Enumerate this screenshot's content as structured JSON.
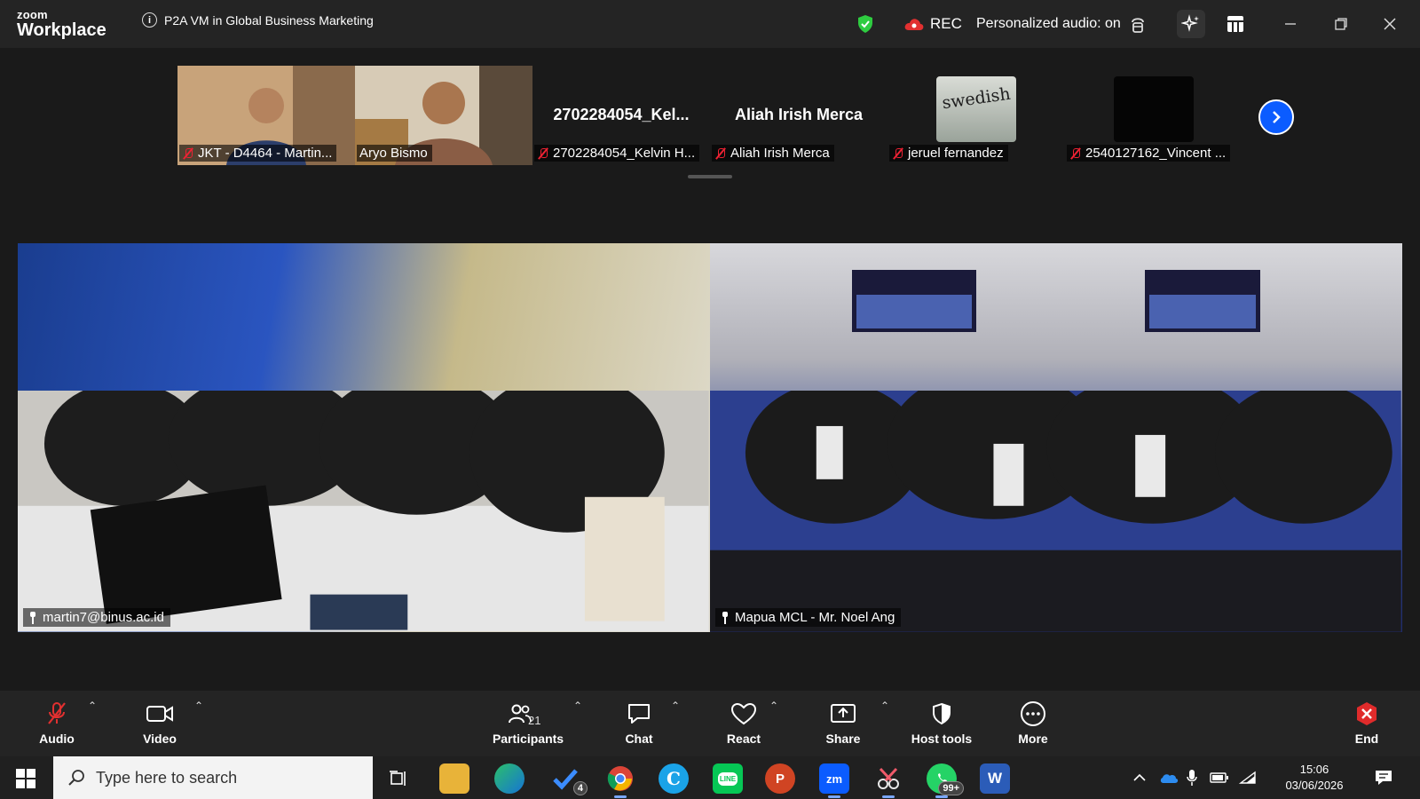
{
  "app": {
    "brand_top": "zoom",
    "brand_bottom": "Workplace"
  },
  "meeting": {
    "title": "P2A VM in Global Business Marketing"
  },
  "header": {
    "rec_label": "REC",
    "personalized_audio": "Personalized audio: on"
  },
  "colors": {
    "accent": "#0b5cff",
    "muted_red": "#e23030",
    "shield_green": "#2ecc40",
    "end_red": "#e02b2b"
  },
  "thumbnails": [
    {
      "big_name": "",
      "name": "JKT - D4464 - Martin...",
      "muted": true,
      "kind": "video"
    },
    {
      "big_name": "",
      "name": "Aryo Bismo",
      "muted": false,
      "kind": "video"
    },
    {
      "big_name": "2702284054_Kel...",
      "name": "2702284054_Kelvin H...",
      "muted": true,
      "kind": "blank"
    },
    {
      "big_name": "Aliah Irish Merca",
      "name": "Aliah Irish Merca",
      "muted": true,
      "kind": "blank"
    },
    {
      "big_name": "",
      "name": "jeruel fernandez",
      "muted": true,
      "kind": "avatar"
    },
    {
      "big_name": "",
      "name": "2540127162_Vincent ...",
      "muted": true,
      "kind": "dark"
    }
  ],
  "avatar_text": "swedish",
  "videos": [
    {
      "name": "martin7@binus.ac.id"
    },
    {
      "name": "Mapua MCL - Mr. Noel Ang"
    }
  ],
  "toolbar": {
    "audio": "Audio",
    "video": "Video",
    "participants": "Participants",
    "participants_count": "21",
    "chat": "Chat",
    "react": "React",
    "share": "Share",
    "host_tools": "Host tools",
    "more": "More",
    "end": "End"
  },
  "taskbar": {
    "search_placeholder": "Type here to search",
    "todo_badge": "4",
    "whatsapp_badge": "99+",
    "time": "15:06",
    "date": "03/06/2026"
  }
}
